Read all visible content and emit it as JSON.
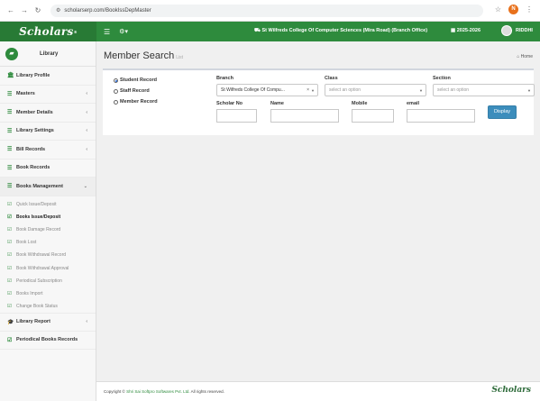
{
  "browser": {
    "url": "scholarserp.com/BookIssDepMaster",
    "profile_initial": "N"
  },
  "header": {
    "logo": "Scholars",
    "college": "St Wilfreds College Of Computer Sciences (Mira Road) (Branch Office)",
    "session": "2025-2026",
    "user": "RIDDHI"
  },
  "sidebar": {
    "title": "Library",
    "items": [
      {
        "label": "Library Profile",
        "icon": "bank-icon"
      },
      {
        "label": "Masters",
        "icon": "list-icon"
      },
      {
        "label": "Member Details",
        "icon": "list-icon"
      },
      {
        "label": "Library Settings",
        "icon": "list-icon"
      },
      {
        "label": "Bill Records",
        "icon": "list-icon"
      },
      {
        "label": "Book Records",
        "icon": "list-icon"
      },
      {
        "label": "Books Management",
        "icon": "list-icon"
      }
    ],
    "sub_items": [
      "Quick Issue/Deposit",
      "Books Issue/Deposit",
      "Book Damage Record",
      "Book Lost",
      "Book Withdrawal Record",
      "Book Withdrawal Approval",
      "Periodical Subscription",
      "Books Import",
      "Change Book Status"
    ],
    "bottom_items": [
      {
        "label": "Library Report",
        "icon": "graduation-cap-icon"
      },
      {
        "label": "Periodical Books Records",
        "icon": "check-square-icon"
      }
    ]
  },
  "page": {
    "title": "Member Search",
    "subtitle": "List",
    "breadcrumb": "Home"
  },
  "form": {
    "radios": [
      "Student Record",
      "Staff Record",
      "Member Record"
    ],
    "selected_radio": "Student Record",
    "branch_label": "Branch",
    "branch_value": "St Wilfreds College Of Compu...",
    "class_label": "Class",
    "class_placeholder": "select an option",
    "section_label": "Section",
    "section_placeholder": "select an option",
    "scholar_label": "Scholar No",
    "name_label": "Name",
    "mobile_label": "Mobile",
    "email_label": "email",
    "display_button": "Display"
  },
  "footer": {
    "copyright_prefix": "Copyright ©",
    "company": "Shri Sai Softpro Softwares Pvt. Ltd.",
    "copyright_suffix": "All rights reserved.",
    "logo": "Scholars"
  },
  "colors": {
    "brand_green": "#2e8b3d",
    "button_blue": "#3c8dbc"
  }
}
